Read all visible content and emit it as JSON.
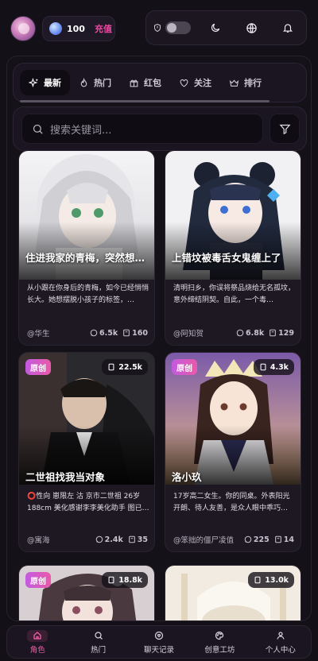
{
  "header": {
    "coin_count": "100",
    "recharge_label": "充值"
  },
  "tabs": [
    {
      "label": "最新",
      "icon": "sparkle-icon",
      "active": true
    },
    {
      "label": "热门",
      "icon": "flame-icon",
      "active": false
    },
    {
      "label": "红包",
      "icon": "gift-icon",
      "active": false
    },
    {
      "label": "关注",
      "icon": "heart-icon",
      "active": false
    },
    {
      "label": "排行",
      "icon": "crown-icon",
      "active": false
    }
  ],
  "search": {
    "placeholder": "搜索关键词..."
  },
  "cards": [
    {
      "title": "住进我家的青梅，突然想…",
      "desc": "从小跟在你身后的青梅，如今已经悄悄长大。她想摆脱小孩子的标签，…",
      "author": "@华生",
      "chats": "6.5k",
      "fans": "160"
    },
    {
      "title": "上错坟被毒舌女鬼缠上了",
      "desc": "清明扫乡，你误将祭品烧给无名孤坟，意外缔结阴契。自此，一个毒…",
      "author": "@阿知贺",
      "chats": "6.8k",
      "fans": "129"
    },
    {
      "badge": "原创",
      "chat_pill": "22.5k",
      "title": "二世祖找我当对象",
      "desc": "⭕性向 崽限左 沽 京市二世祖 26岁 188cm 美化感谢李李美化助手 图已…",
      "author": "@寓海",
      "chats": "2.4k",
      "fans": "35"
    },
    {
      "badge": "原创",
      "chat_pill": "4.3k",
      "title": "洛小玖",
      "desc": "17岁高二女生。你的同桌。外表阳光开朗、待人友善，是众人眼中乖巧…",
      "author": "@笨拙的僵尸凌值",
      "chats": "225",
      "fans": "14"
    },
    {
      "badge": "原创",
      "chat_pill": "18.8k"
    },
    {
      "chat_pill": "13.0k"
    }
  ],
  "bottom_nav": [
    {
      "label": "角色",
      "icon": "home-icon",
      "active": true
    },
    {
      "label": "热门",
      "icon": "search-icon",
      "active": false
    },
    {
      "label": "聊天记录",
      "icon": "chat-heart-icon",
      "active": false
    },
    {
      "label": "创意工坊",
      "icon": "palette-icon",
      "active": false
    },
    {
      "label": "个人中心",
      "icon": "user-icon",
      "active": false
    }
  ],
  "colors": {
    "accent": "#e94aa2",
    "background": "#141018"
  }
}
